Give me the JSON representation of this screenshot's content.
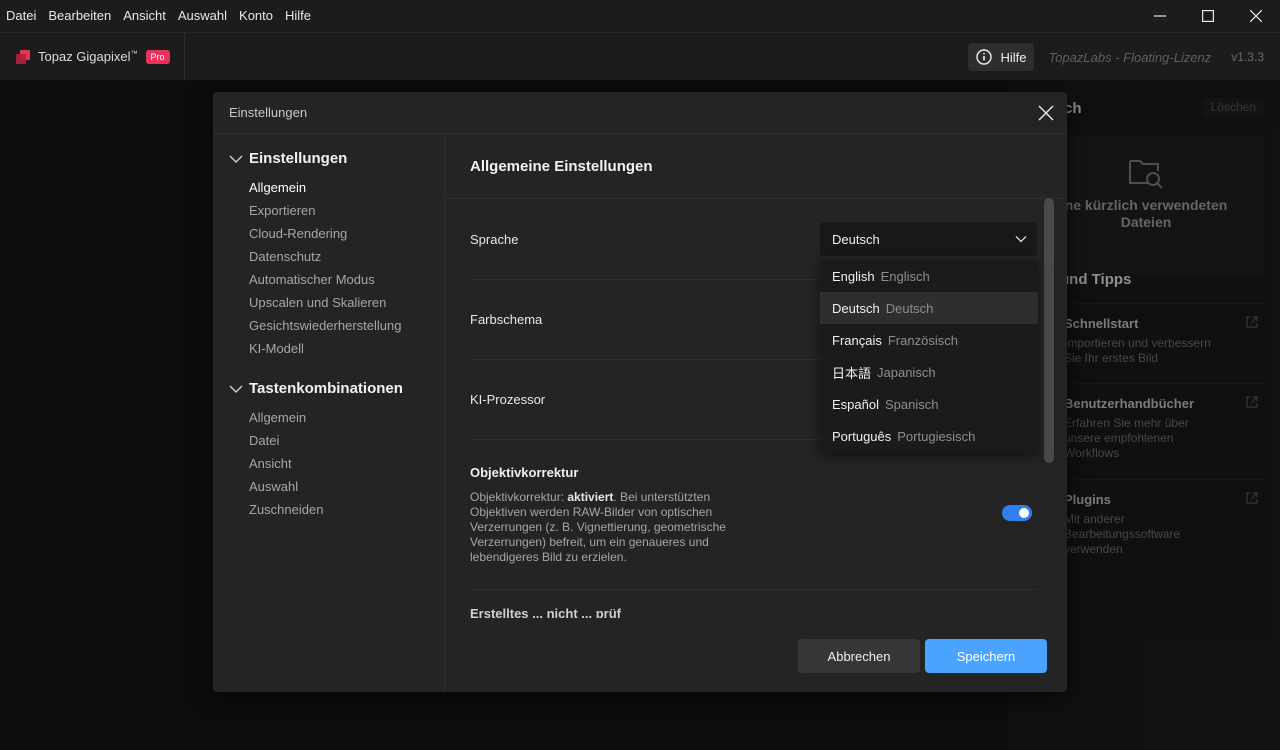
{
  "menubar": {
    "items": [
      "Datei",
      "Bearbeiten",
      "Ansicht",
      "Auswahl",
      "Konto",
      "Hilfe"
    ]
  },
  "window_controls": [
    "minimize-icon",
    "maximize-icon",
    "close-icon"
  ],
  "app": {
    "name": "Topaz Gigapixel",
    "trademark": "™",
    "badge": "Pro",
    "help_label": "Hilfe",
    "license": "TopazLabs - Floating-Lizenz",
    "version": "v1.3.3",
    "accent_color": "#4aa3ff",
    "brand_color": "#e8335a"
  },
  "right_panel": {
    "title_fragment": "ch",
    "clear_label": "Löschen",
    "recent_empty": [
      "ne kürzlich verwendeten",
      "Dateien"
    ],
    "tips_title": "und Tipps",
    "items": [
      {
        "title": "Schnellstart",
        "desc": [
          "Importieren und verbessern",
          "Sie Ihr erstes Bild"
        ]
      },
      {
        "title": "Benutzerhandbücher",
        "desc": [
          "Erfahren Sie mehr über",
          "unsere empfohlenen",
          "Workflows"
        ]
      },
      {
        "title": "Plugins",
        "desc": [
          "Mit anderer",
          "Bearbeitungssoftware",
          "verwenden"
        ]
      }
    ]
  },
  "dialog": {
    "title": "Einstellungen",
    "nav": {
      "sections": [
        {
          "label": "Einstellungen",
          "items": [
            "Allgemein",
            "Exportieren",
            "Cloud-Rendering",
            "Datenschutz",
            "Automatischer Modus",
            "Upscalen und Skalieren",
            "Gesichtswiederherstellung",
            "KI-Modell"
          ],
          "active": 0
        },
        {
          "label": "Tastenkombinationen",
          "items": [
            "Allgemein",
            "Datei",
            "Ansicht",
            "Auswahl",
            "Zuschneiden"
          ]
        }
      ]
    },
    "content": {
      "title": "Allgemeine Einstellungen",
      "language_label": "Sprache",
      "language_value": "Deutsch",
      "color_scheme_label": "Farbschema",
      "ai_processor_label": "KI-Prozessor",
      "lens_title": "Objektivkorrektur",
      "lens_desc_prefix": "Objektivkorrektur: ",
      "lens_desc_status": "aktiviert",
      "lens_desc_rest": ". Bei unterstützten Objektiven werden RAW-Bilder von optischen Verzerrungen (z. B. Vignettierung, geometrische Verzerrungen) befreit, um ein genaueres und lebendigeres Bild zu erzielen.",
      "lens_enabled": true,
      "cut_off_label": "Erstelltes ... nicht ... prüf"
    },
    "language_options": [
      {
        "native": "English",
        "translated": "Englisch"
      },
      {
        "native": "Deutsch",
        "translated": "Deutsch",
        "selected": true
      },
      {
        "native": "Français",
        "translated": "Französisch"
      },
      {
        "native": "日本語",
        "translated": "Japanisch"
      },
      {
        "native": "Español",
        "translated": "Spanisch"
      },
      {
        "native": "Português",
        "translated": "Portugiesisch"
      }
    ],
    "buttons": {
      "cancel": "Abbrechen",
      "save": "Speichern"
    }
  }
}
